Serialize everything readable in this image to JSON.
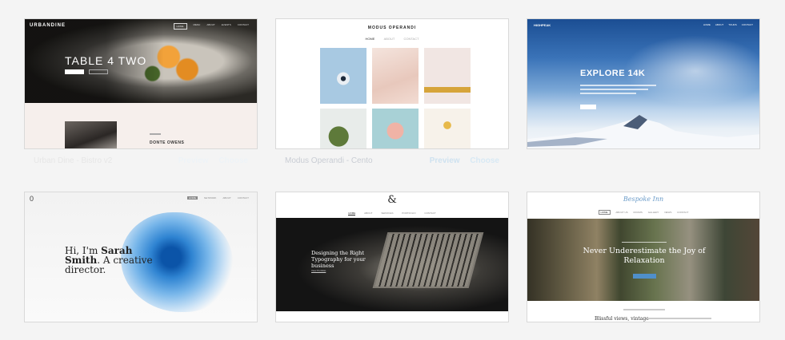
{
  "templates": [
    {
      "logo": "URBANDINE",
      "nav": [
        "HOME",
        "MENU",
        "ABOUT",
        "EVENTS",
        "CONTACT"
      ],
      "title": "TABLE 4 TWO",
      "person_name": "DONTE OWENS",
      "caption": {
        "name": "Urban Dine - Bistro v2",
        "preview": "Preview",
        "choose": "Choose"
      }
    },
    {
      "brand": "MODUS OPERANDI",
      "nav": [
        "HOME",
        "ABOUT",
        "CONTACT"
      ],
      "caption": {
        "name": "Modus Operandi - Cento",
        "preview": "Preview",
        "choose": "Choose"
      }
    },
    {
      "logo": "HIGHPEAK",
      "nav": [
        "HOME",
        "ABOUT",
        "TOURS",
        "CONTACT"
      ],
      "title": "EXPLORE 14K"
    },
    {
      "logo": "0",
      "nav": [
        "HOME",
        "NETWORK",
        "ABOUT",
        "CONTACT"
      ],
      "headline_pre": "Hi, I'm ",
      "headline_bold": "Sarah Smith",
      "headline_post": ". A creative director."
    },
    {
      "logo": "&",
      "nav": [
        "HOME",
        "ABOUT",
        "SERVICES",
        "PORTFOLIO",
        "CONTACT"
      ],
      "headline": "Designing the Right Typography for your business",
      "link": "View Portfolio"
    },
    {
      "logo": "Bespoke Inn",
      "nav": [
        "HOME",
        "ABOUT US",
        "ROOMS",
        "GALLERY",
        "NEWS",
        "CONTACT"
      ],
      "headline": "Never Underestimate the Joy of Relaxation",
      "sub": "Blissful views, vintage"
    }
  ],
  "colors": {
    "background": "#f4f4f4",
    "caption_text": "#c9cdd4",
    "preview_link": "#cfe2f0",
    "accent_blue": "#4f8fca"
  }
}
